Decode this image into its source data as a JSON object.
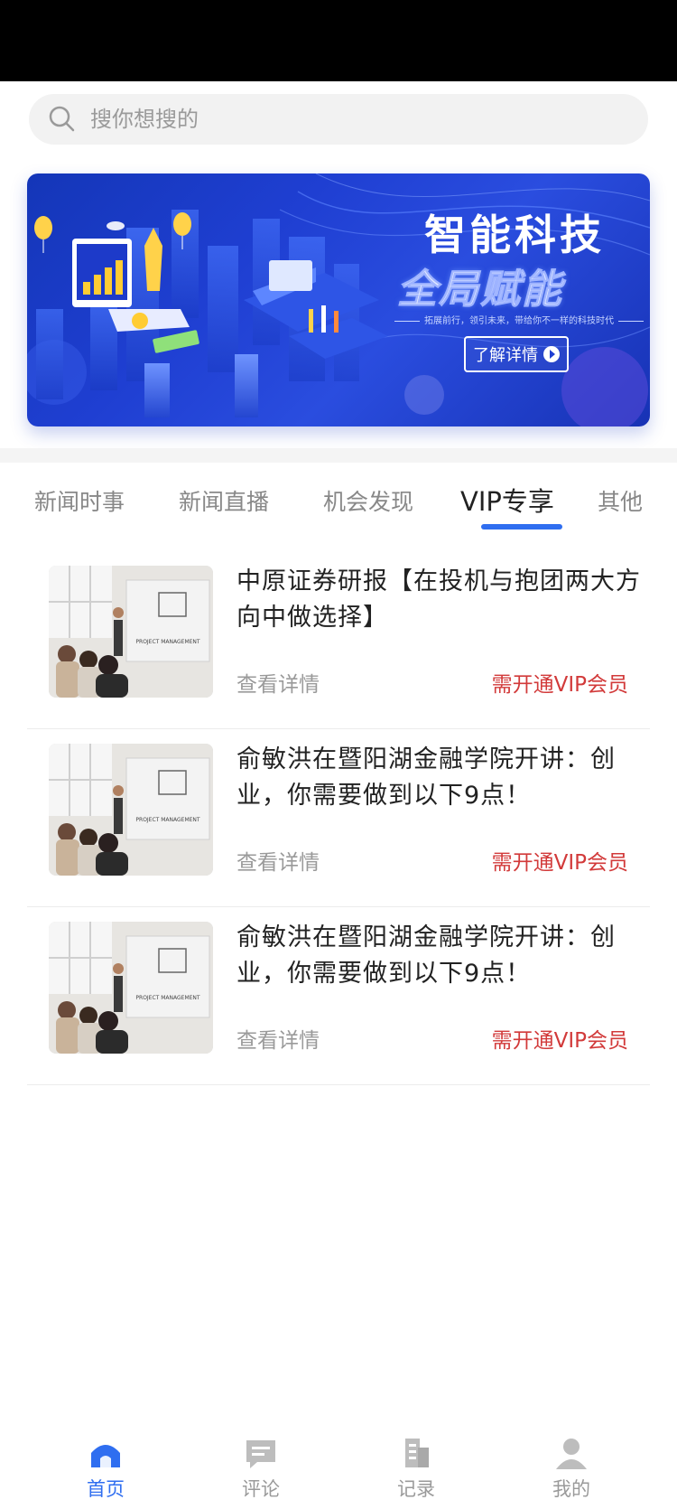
{
  "search": {
    "placeholder": "搜你想搜的"
  },
  "banner": {
    "title": "智能科技",
    "subtitle": "全局赋能",
    "tagline": "拓展前行，领引未来，带给你不一样的科技时代",
    "button_label": "了解详情"
  },
  "tabs": [
    {
      "label": "新闻时事",
      "active": false
    },
    {
      "label": "新闻直播",
      "active": false
    },
    {
      "label": "机会发现",
      "active": false
    },
    {
      "label": "VIP专享",
      "active": true
    },
    {
      "label": "其他",
      "active": false
    }
  ],
  "articles": [
    {
      "title": "中原证券研报【在投机与抱团两大方向中做选择】",
      "link_label": "查看详情",
      "vip_label": "需开通VIP会员",
      "thumb_caption": "PROJECT MANAGEMENT"
    },
    {
      "title": "俞敏洪在暨阳湖金融学院开讲：创业，你需要做到以下9点！",
      "link_label": "查看详情",
      "vip_label": "需开通VIP会员",
      "thumb_caption": "PROJECT MANAGEMENT"
    },
    {
      "title": "俞敏洪在暨阳湖金融学院开讲：创业，你需要做到以下9点！",
      "link_label": "查看详情",
      "vip_label": "需开通VIP会员",
      "thumb_caption": "PROJECT MANAGEMENT"
    }
  ],
  "bottom_nav": [
    {
      "label": "首页",
      "icon": "home-icon",
      "active": true
    },
    {
      "label": "评论",
      "icon": "comment-icon",
      "active": false
    },
    {
      "label": "记录",
      "icon": "record-icon",
      "active": false
    },
    {
      "label": "我的",
      "icon": "profile-icon",
      "active": false
    }
  ],
  "colors": {
    "accent": "#2f6ef0",
    "vip_red": "#d23a3a",
    "banner_blue": "#1f3fd2"
  }
}
